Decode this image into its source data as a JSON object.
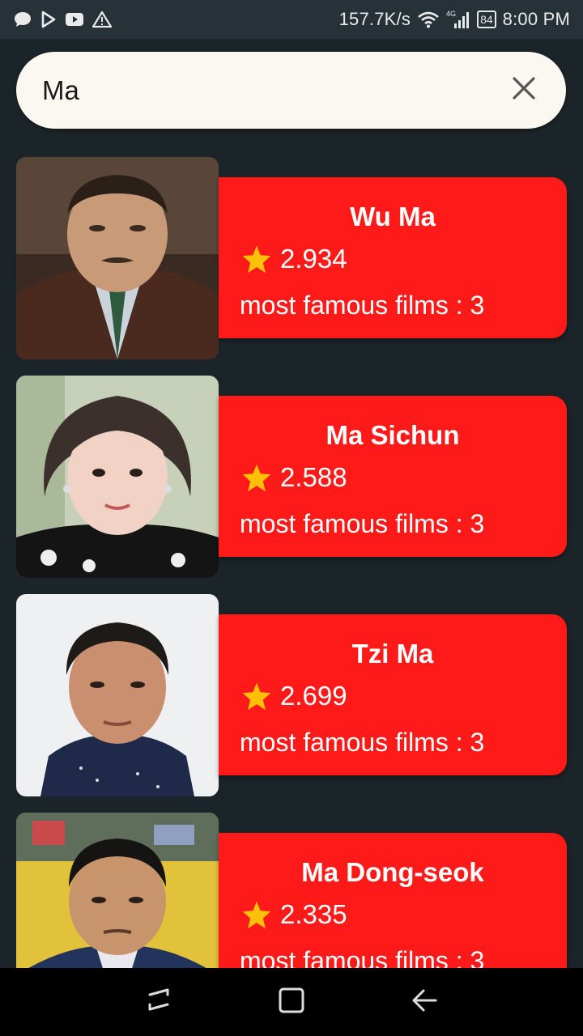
{
  "status_bar": {
    "net_speed": "157.7K/s",
    "network_type": "4G",
    "battery": "84",
    "time": "8:00 PM",
    "left_icons": [
      "message-icon",
      "play-store-icon",
      "youtube-icon",
      "warning-icon"
    ],
    "right_icons": [
      "wifi-icon",
      "signal-icon",
      "battery-icon"
    ]
  },
  "search": {
    "value": "Ma",
    "clear_icon": "close-icon"
  },
  "labels": {
    "films_prefix": "most famous films : "
  },
  "results": [
    {
      "name": "Wu Ma",
      "rating": "2.934",
      "films_text": "most famous films : 3"
    },
    {
      "name": "Ma Sichun",
      "rating": "2.588",
      "films_text": "most famous films : 3"
    },
    {
      "name": "Tzi Ma",
      "rating": "2.699",
      "films_text": "most famous films : 3"
    },
    {
      "name": "Ma Dong-seok",
      "rating": "2.335",
      "films_text": "most famous films : 3"
    }
  ],
  "nav": {
    "icons": [
      "recent-apps-icon",
      "home-icon",
      "back-icon"
    ]
  },
  "colors": {
    "background": "#1b2428",
    "status_bar": "#263238",
    "search_bg": "#fbf8f1",
    "card_red": "#ff1a1a",
    "star": "#ffc107"
  }
}
